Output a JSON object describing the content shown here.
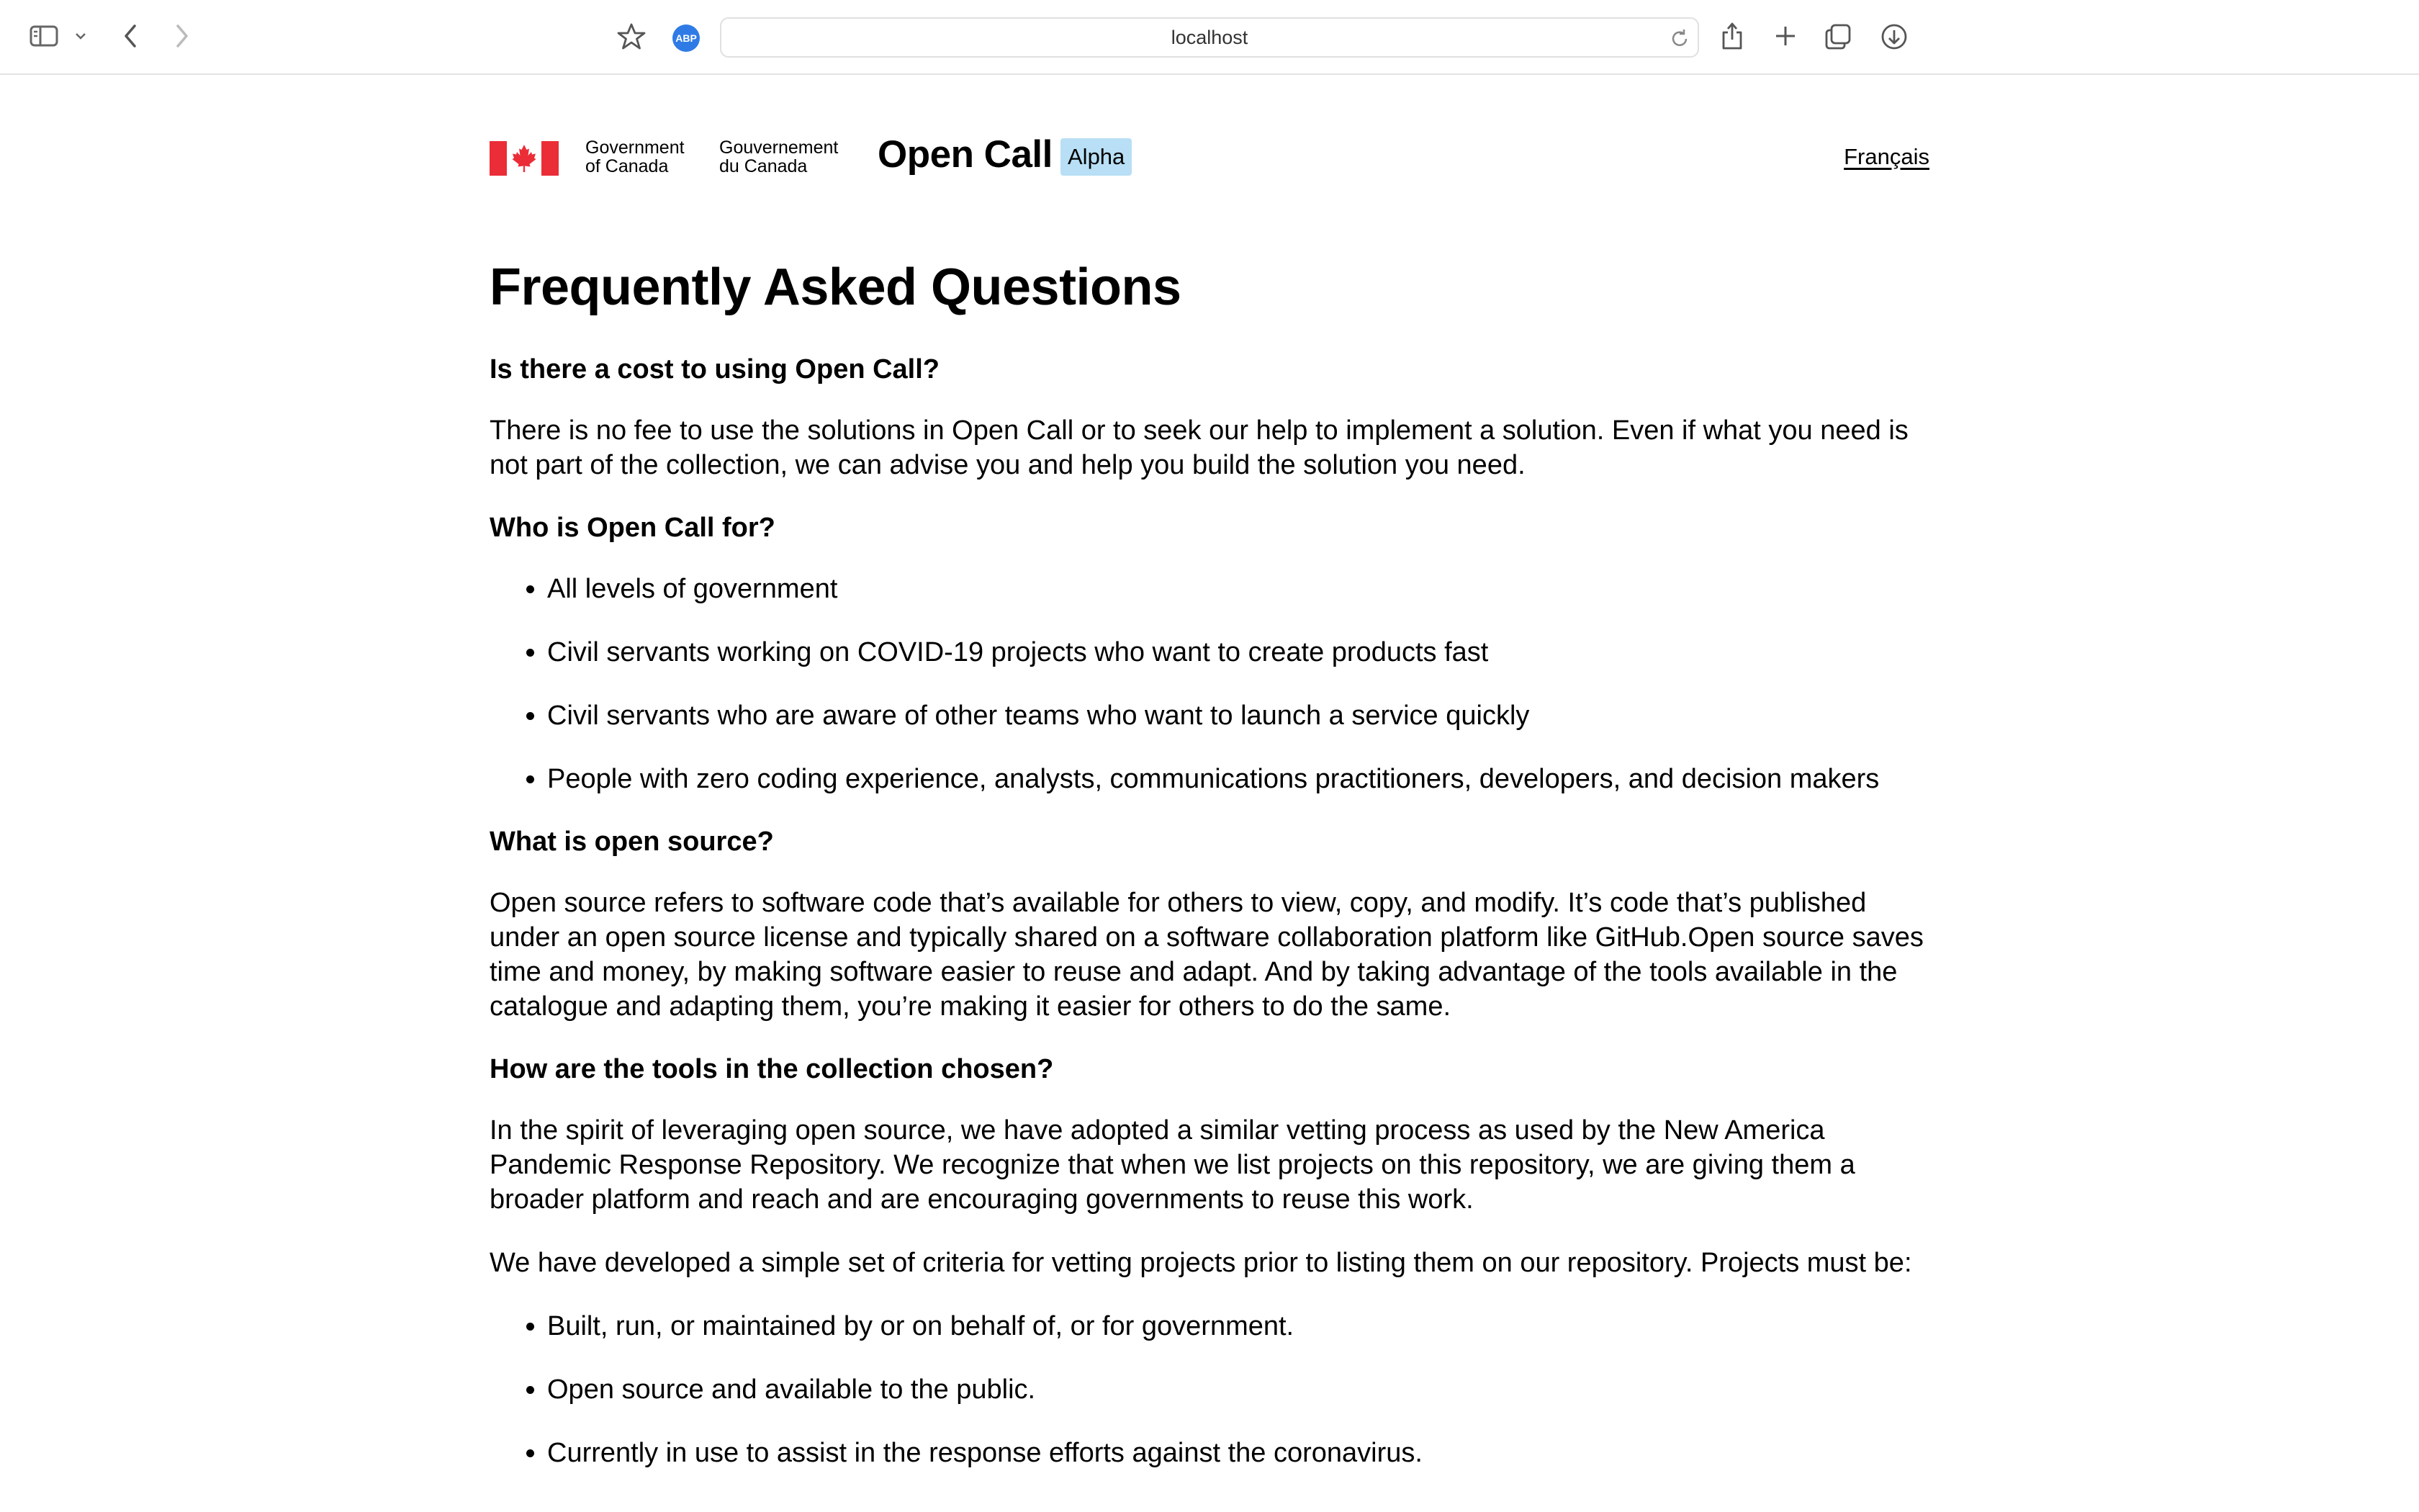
{
  "browser": {
    "url": "localhost",
    "extension_label": "ABP"
  },
  "header": {
    "fip_en_line1": "Government",
    "fip_en_line2": "of Canada",
    "fip_fr_line1": "Gouvernement",
    "fip_fr_line2": "du Canada",
    "site_title": "Open Call",
    "badge": "Alpha",
    "language_link": "Français"
  },
  "colors": {
    "flag_red": "#eb2d37",
    "badge_bg": "#b8dff5"
  },
  "main": {
    "title": "Frequently Asked Questions",
    "sections": [
      {
        "question": "Is there a cost to using Open Call?",
        "paragraphs": [
          "There is no fee to use the solutions in Open Call or to seek our help to implement a solution. Even if what you need is not part of the collection, we can advise you and help you build the solution you need."
        ]
      },
      {
        "question": "Who is Open Call for?",
        "bullets": [
          "All levels of government",
          "Civil servants working on COVID-19 projects who want to create products fast",
          "Civil servants who are aware of other teams who want to launch a service quickly",
          "People with zero coding experience, analysts, communications practitioners, developers, and decision makers"
        ]
      },
      {
        "question": "What is open source?",
        "paragraphs": [
          "Open source refers to software code that’s available for others to view, copy, and modify. It’s code that’s published under an open source license and typically shared on a software collaboration platform like GitHub.Open source saves time and money, by making software easier to reuse and adapt. And by taking advantage of the tools available in the catalogue and adapting them, you’re making it easier for others to do the same."
        ]
      },
      {
        "question": "How are the tools in the collection chosen?",
        "paragraphs": [
          "In the spirit of leveraging open source, we have adopted a similar vetting process as used by the New America Pandemic Response Repository. We recognize that when we list projects on this repository, we are giving them a broader platform and reach and are encouraging governments to reuse this work.",
          "We have developed a simple set of criteria for vetting projects prior to listing them on our repository. Projects must be:"
        ],
        "bullets": [
          "Built, run, or maintained by or on behalf of, or for government.",
          "Open source and available to the public.",
          "Currently in use to assist in the response efforts against the coronavirus."
        ]
      }
    ]
  }
}
